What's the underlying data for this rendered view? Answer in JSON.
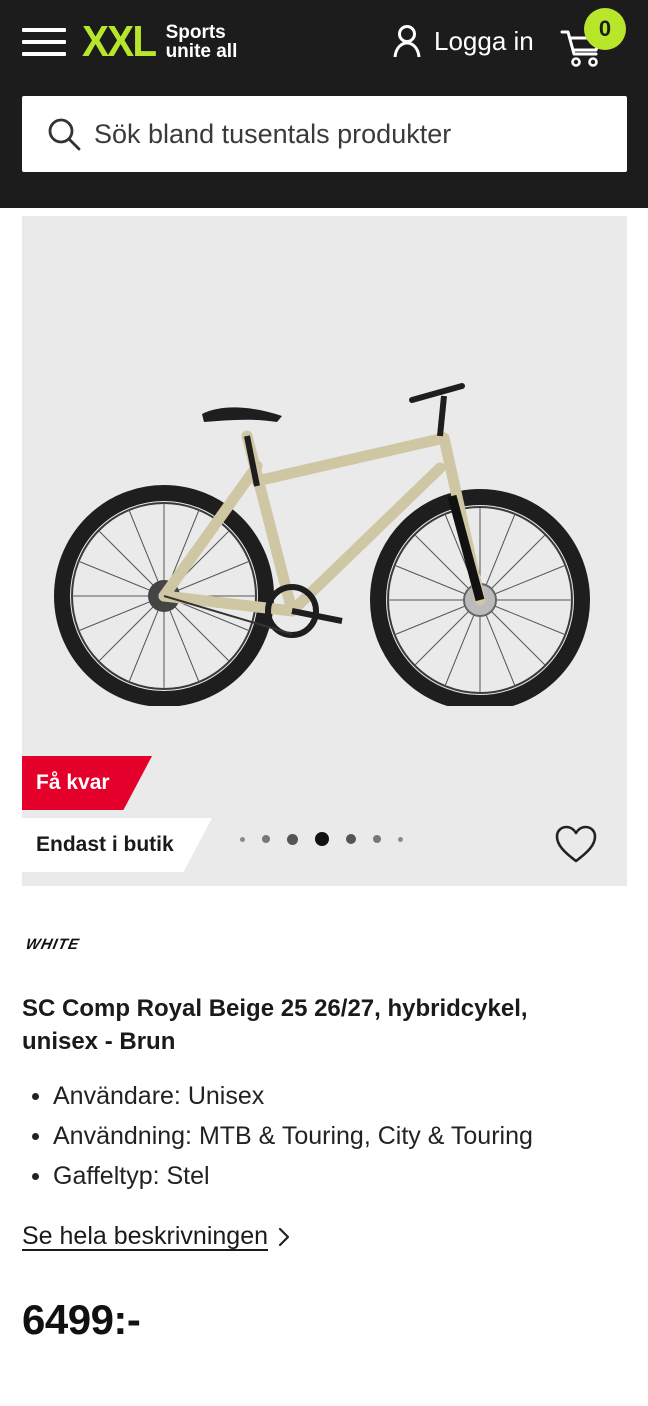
{
  "header": {
    "logo_mark": "XXL",
    "logo_tagline_1": "Sports",
    "logo_tagline_2": "unite all",
    "login_label": "Logga in",
    "cart_count": "0",
    "accent_color": "#b8e62a",
    "background_color": "#1c1c1c"
  },
  "search": {
    "placeholder": "Sök bland tusentals produkter",
    "icon": "search-icon"
  },
  "gallery": {
    "badge_few_left": "Få kvar",
    "badge_store_only": "Endast i butik",
    "badge_color": "#e4002b",
    "current_image_index": 4,
    "image_count": 7,
    "favorite_icon": "heart-icon"
  },
  "product": {
    "brand": "WHITE",
    "title": "SC Comp Royal Beige 25 26/27, hybridcykel, unisex - Brun",
    "specs": [
      "Användare: Unisex",
      "Användning: MTB & Touring, City & Touring",
      "Gaffeltyp: Stel"
    ],
    "description_link": "Se hela beskrivningen",
    "price": "6499:-"
  }
}
